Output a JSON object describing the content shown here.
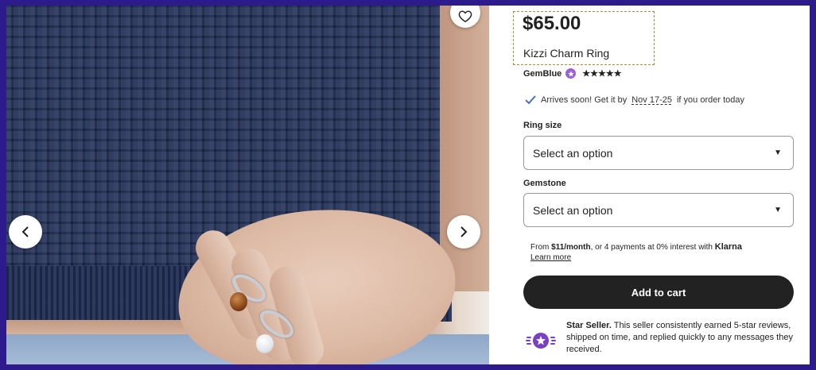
{
  "gallery": {
    "prev_icon": "chevron-left-icon",
    "next_icon": "chevron-right-icon",
    "favorite_icon": "heart-icon"
  },
  "product": {
    "price": "$65.00",
    "title": "Kizzi Charm Ring",
    "seller": "GemBlue",
    "rating_stars": 5,
    "rating_glyphs": "★★★★★"
  },
  "delivery": {
    "prefix": "Arrives soon! Get it by",
    "date": "Nov 17-25",
    "suffix": "if you order today"
  },
  "options": {
    "ring_size": {
      "label": "Ring size",
      "value": "Select an option"
    },
    "gemstone": {
      "label": "Gemstone",
      "value": "Select an option"
    }
  },
  "financing": {
    "prefix": "From",
    "amount": "$11/month",
    "middle": ", or 4 payments at 0% interest with",
    "provider": "Klarna",
    "learn_more": "Learn more"
  },
  "cart": {
    "label": "Add to cart"
  },
  "star_seller": {
    "title": "Star Seller.",
    "description": "This seller consistently earned 5-star reviews, shipped on time, and replied quickly to any messages they received."
  },
  "colors": {
    "page_background": "#2d1a8c",
    "button": "#222222",
    "star_seller_badge": "#7b3fc4"
  }
}
